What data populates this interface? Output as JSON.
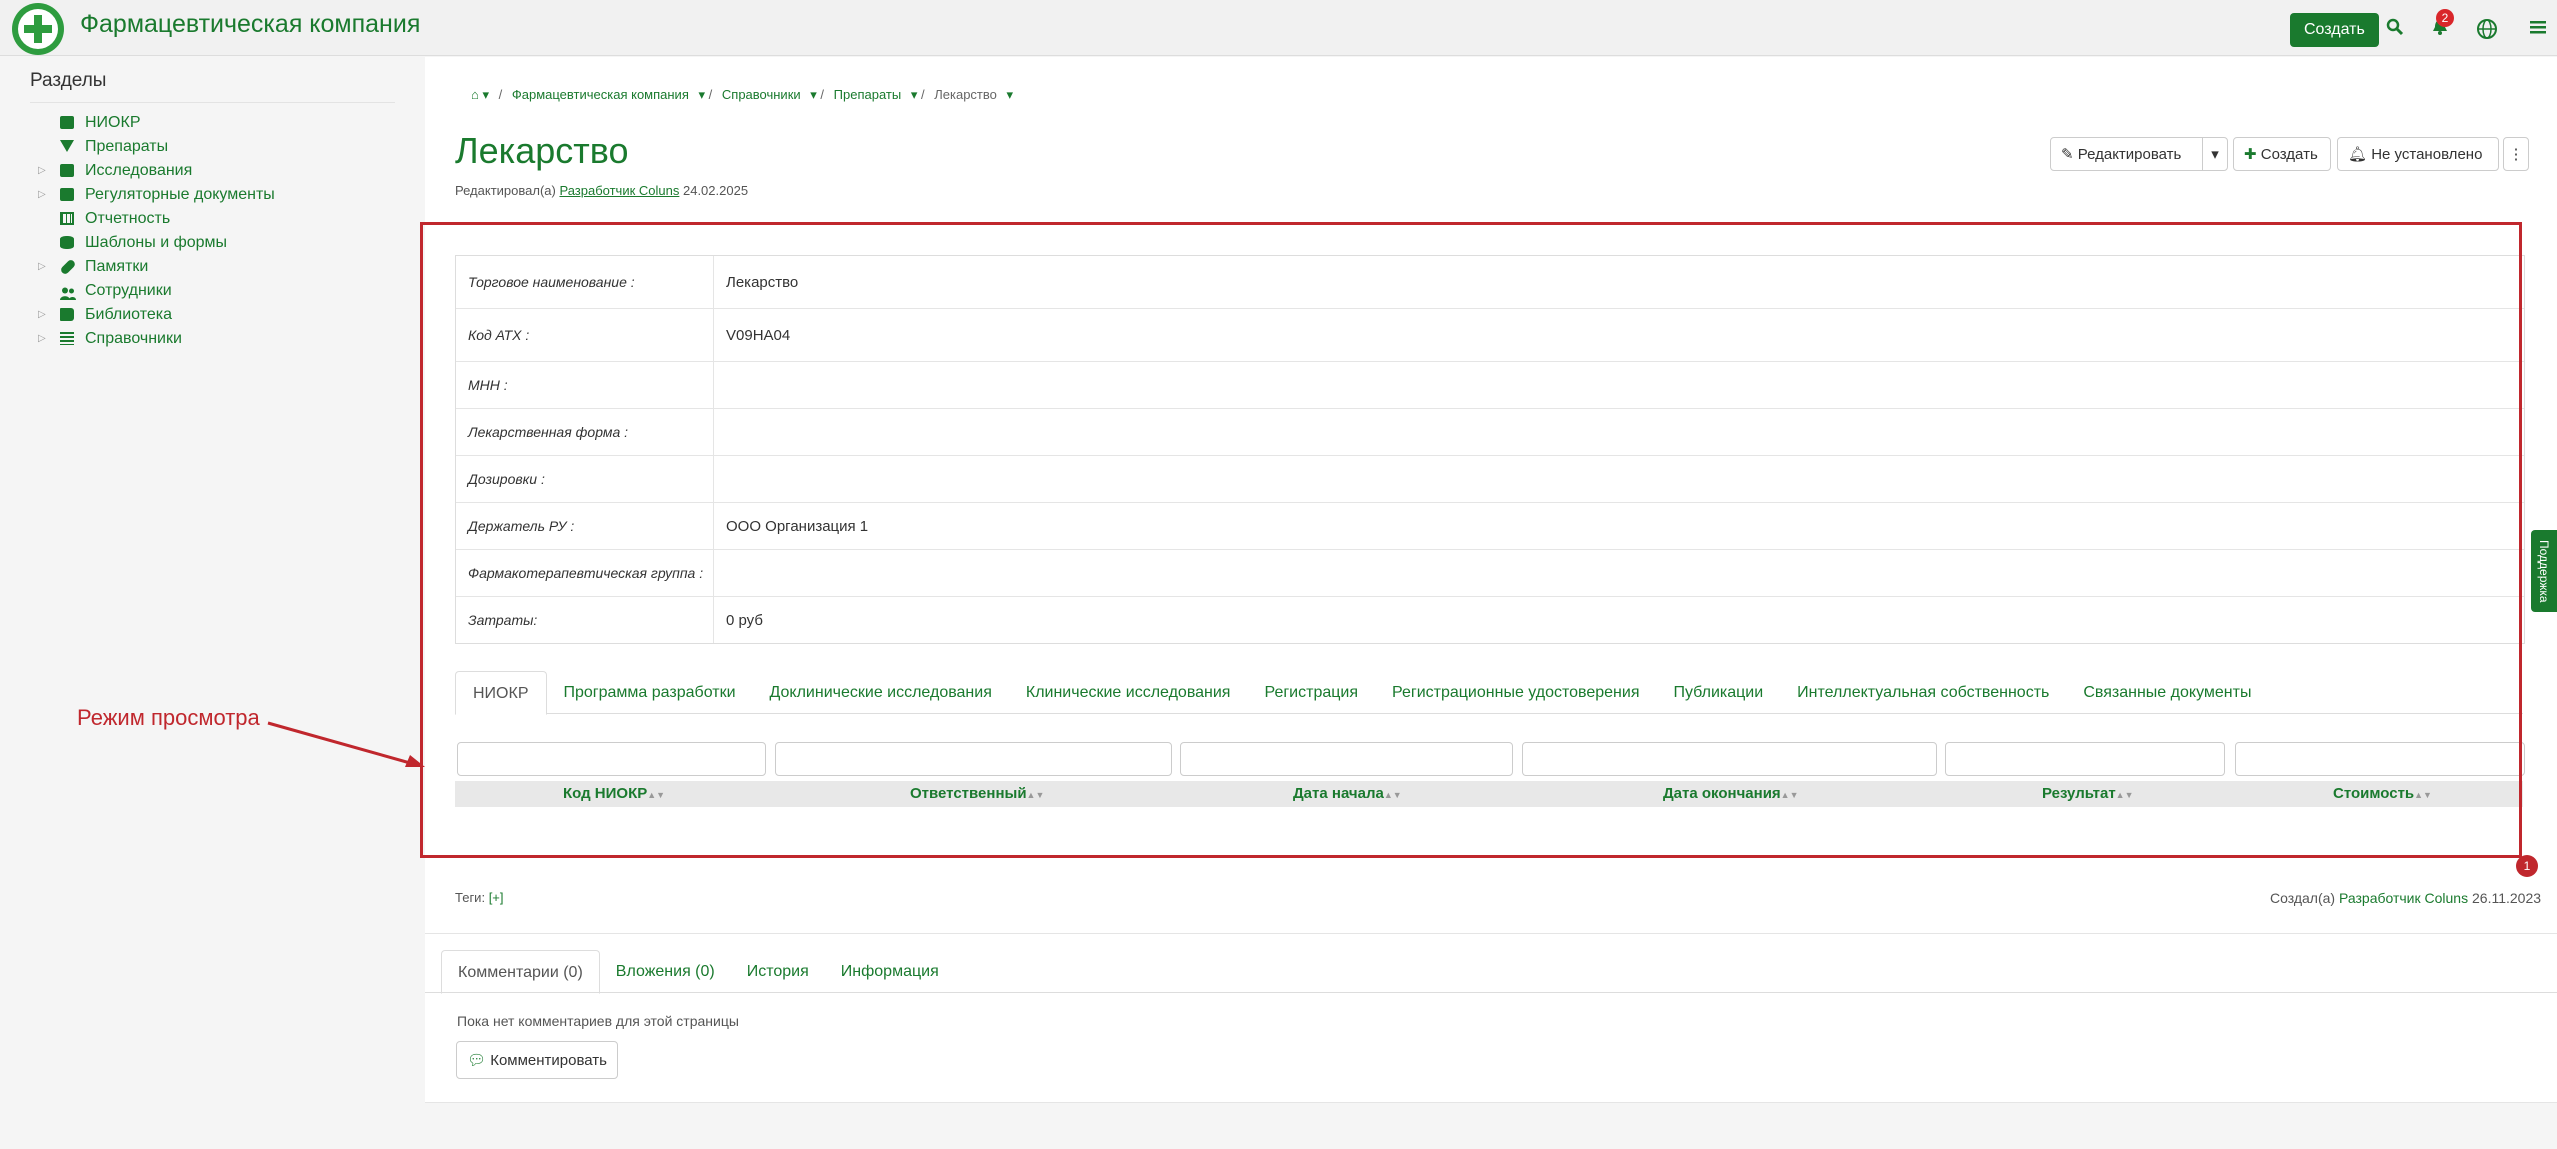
{
  "header": {
    "app_title": "Фармацевтическая компания",
    "create_label": "Создать",
    "notification_count": "2"
  },
  "sidebar": {
    "title": "Разделы",
    "items": [
      {
        "label": "НИОКР",
        "icon": "briefcase-icon",
        "expandable": false
      },
      {
        "label": "Препараты",
        "icon": "filter-icon",
        "expandable": false
      },
      {
        "label": "Исследования",
        "icon": "briefcase-icon",
        "expandable": true
      },
      {
        "label": "Регуляторные документы",
        "icon": "briefcase-icon",
        "expandable": true
      },
      {
        "label": "Отчетность",
        "icon": "table-icon",
        "expandable": false
      },
      {
        "label": "Шаблоны и формы",
        "icon": "database-icon",
        "expandable": false
      },
      {
        "label": "Памятки",
        "icon": "pill-icon",
        "expandable": true
      },
      {
        "label": "Сотрудники",
        "icon": "users-icon",
        "expandable": false
      },
      {
        "label": "Библиотека",
        "icon": "book-icon",
        "expandable": true
      },
      {
        "label": "Справочники",
        "icon": "list-icon",
        "expandable": true
      }
    ]
  },
  "breadcrumb": {
    "items": [
      "Фармацевтическая компания",
      "Справочники",
      "Препараты",
      "Лекарство"
    ]
  },
  "page": {
    "title": "Лекарство",
    "edited_prefix": "Редактировал(а)",
    "edited_by": "Разработчик Coluns",
    "edited_date": "24.02.2025"
  },
  "actions": {
    "edit": "Редактировать",
    "create": "Создать",
    "not_set": "Не установлено"
  },
  "properties": [
    {
      "label": "Торговое наименование :",
      "value": "Лекарство"
    },
    {
      "label": "Код АТХ :",
      "value": "V09HA04"
    },
    {
      "label": "МНН :",
      "value": ""
    },
    {
      "label": "Лекарственная форма :",
      "value": ""
    },
    {
      "label": "Дозировки :",
      "value": ""
    },
    {
      "label": "Держатель РУ :",
      "value": "ООО Организация 1"
    },
    {
      "label": "Фармакотерапевтическая группа :",
      "value": ""
    },
    {
      "label": "Затраты:",
      "value": "0 руб"
    }
  ],
  "tabs": [
    "НИОКР",
    "Программа разработки",
    "Доклинические исследования",
    "Клинические исследования",
    "Регистрация",
    "Регистрационные удостоверения",
    "Публикации",
    "Интеллектуальная собственность",
    "Связанные документы"
  ],
  "grid": {
    "columns": [
      "Код НИОКР",
      "Ответственный",
      "Дата начала",
      "Дата окончания",
      "Результат",
      "Стоимость"
    ]
  },
  "footer": {
    "tags_label": "Теги:",
    "tags_add": "[+]",
    "created_prefix": "Создал(а)",
    "created_by": "Разработчик Coluns",
    "created_date": "26.11.2023"
  },
  "comments": {
    "tabs": [
      "Комментарии (0)",
      "Вложения (0)",
      "История",
      "Информация"
    ],
    "empty_text": "Пока нет комментариев для этой страницы",
    "comment_button": "Комментировать"
  },
  "support_label": "Поддержка",
  "annotation": {
    "label": "Режим просмотра",
    "marker": "1"
  },
  "colors": {
    "accent": "#1a7a2e",
    "annotation": "#c0272d"
  }
}
